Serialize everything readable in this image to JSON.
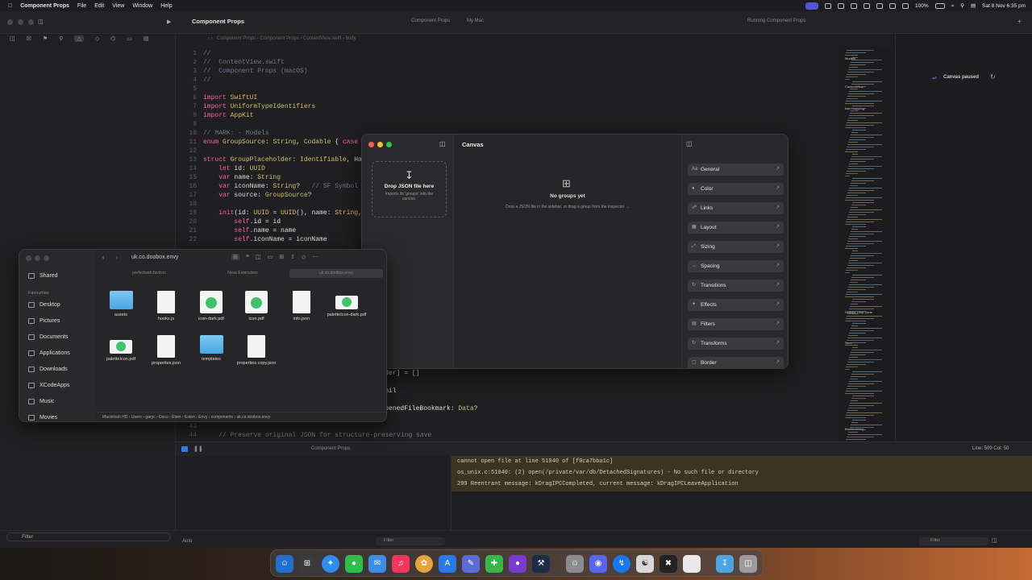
{
  "menubar": {
    "app_name": "Component Props",
    "items": [
      "File",
      "Edit",
      "View",
      "Window",
      "Help"
    ],
    "battery": "100%",
    "datetime": "Sat 8 Nov  6:35 pm"
  },
  "xcode": {
    "window_title": "Component Props",
    "run_destination": "Component Props",
    "destination_device": "My Mac",
    "status": "Running Component Props",
    "canvas_status": "Canvas paused",
    "code_lines": [
      {
        "n": "1",
        "text": "//"
      },
      {
        "n": "2",
        "text": "//  ContentView.swift"
      },
      {
        "n": "3",
        "text": "//  Component Props (macOS)"
      },
      {
        "n": "4",
        "text": "//"
      },
      {
        "n": "5",
        "text": ""
      },
      {
        "n": "6",
        "text": "import SwiftUI"
      },
      {
        "n": "7",
        "text": "import UniformTypeIdentifiers"
      },
      {
        "n": "8",
        "text": "import AppKit"
      },
      {
        "n": "9",
        "text": ""
      },
      {
        "n": "10",
        "text": "// MARK: - Models"
      },
      {
        "n": "11",
        "text": "enum GroupSource: String, Codable { case"
      },
      {
        "n": "12",
        "text": ""
      },
      {
        "n": "13",
        "text": "struct GroupPlaceholder: Identifiable, Ha"
      },
      {
        "n": "14",
        "text": "    let id: UUID"
      },
      {
        "n": "15",
        "text": "    var name: String"
      },
      {
        "n": "16",
        "text": "    var iconName: String?   // SF Symbol"
      },
      {
        "n": "17",
        "text": "    var source: GroupSource?"
      },
      {
        "n": "18",
        "text": ""
      },
      {
        "n": "19",
        "text": "    init(id: UUID = UUID(), name: String,"
      },
      {
        "n": "20",
        "text": "        self.id = id"
      },
      {
        "n": "21",
        "text": "        self.name = name"
      },
      {
        "n": "22",
        "text": "        self.iconName = iconName"
      }
    ],
    "code_tail": [
      {
        "n": "",
        "text": "eholder] = []"
      },
      {
        "n": "",
        "text": "? = nil"
      },
      {
        "n": "",
        "text": "ar openedFileBookmark: Data?"
      },
      {
        "n": "43",
        "text": ""
      },
      {
        "n": "44",
        "text": "    // Preserve original JSON for structure-preserving save"
      }
    ],
    "minimap_labels": [
      "Models",
      "ContentView",
      "Icon mapping",
      "Sidebar Drop Zone",
      "Save",
      "Bookmarking"
    ],
    "cursor_pos": "Line: 509  Col: 50",
    "debug_target": "Component Props",
    "console_lines": [
      "cannot open file at line 51040 of [f0ca7bba1c]",
      "os_unix.c:51040: (2) open(/private/var/db/DetachedSignatures) - No such file or directory",
      "299 Reentrant message: kDragIPCCompleted, current message: kDragIPCLeaveApplication"
    ],
    "auto_label": "Auto",
    "filter_placeholder": "Filter"
  },
  "canvas_app": {
    "title": "Canvas",
    "drop_title": "Drop JSON file here",
    "drop_sub": "Imports its 'groups' into the canvas.",
    "empty_title": "No groups yet",
    "empty_sub": "Drop a JSON file in the sidebar, or drag a group from the inspector →",
    "inspector_items": [
      {
        "label": "General",
        "icon": "Aa"
      },
      {
        "label": "Color",
        "icon": "●"
      },
      {
        "label": "Links",
        "icon": "☍"
      },
      {
        "label": "Layout",
        "icon": "▦"
      },
      {
        "label": "Sizing",
        "icon": "⤢"
      },
      {
        "label": "Spacing",
        "icon": "↔"
      },
      {
        "label": "Transitions",
        "icon": "↻"
      },
      {
        "label": "Effects",
        "icon": "✦"
      },
      {
        "label": "Filters",
        "icon": "▤"
      },
      {
        "label": "Transforms",
        "icon": "↻"
      },
      {
        "label": "Border",
        "icon": "▢"
      }
    ]
  },
  "finder": {
    "title": "uk.co.doobox.envy",
    "tabs": [
      "perfectweb.favicon",
      "Nova Extensions",
      "uk.co.doobox.envy"
    ],
    "sidebar": {
      "shared": "Shared",
      "favourites_heading": "Favourites",
      "items": [
        "Desktop",
        "Pictures",
        "Documents",
        "Applications",
        "Downloads",
        "XCodeApps",
        "Music",
        "Movies"
      ]
    },
    "files": [
      {
        "name": "assets",
        "kind": "folder"
      },
      {
        "name": "hooks.js",
        "kind": "doc"
      },
      {
        "name": "icon-dark.pdf",
        "kind": "badge"
      },
      {
        "name": "icon.pdf",
        "kind": "badge"
      },
      {
        "name": "info.json",
        "kind": "doc"
      },
      {
        "name": "paletteIcon-dark.pdf",
        "kind": "palette"
      },
      {
        "name": "paletteIcon.pdf",
        "kind": "palette"
      },
      {
        "name": "properties.json",
        "kind": "doc"
      },
      {
        "name": "templates",
        "kind": "folder"
      },
      {
        "name": "properties copy.json",
        "kind": "doc"
      }
    ],
    "path": [
      "Macintosh HD",
      "Users",
      "garyc",
      "Docu",
      "Elem",
      "Exten",
      "Envy",
      "components",
      "uk.co.doobox.envy"
    ]
  },
  "colors": {
    "accent_blue": "#2f7cf6",
    "console_bg": "#3a3420",
    "keyword": "#fc5fa3"
  }
}
